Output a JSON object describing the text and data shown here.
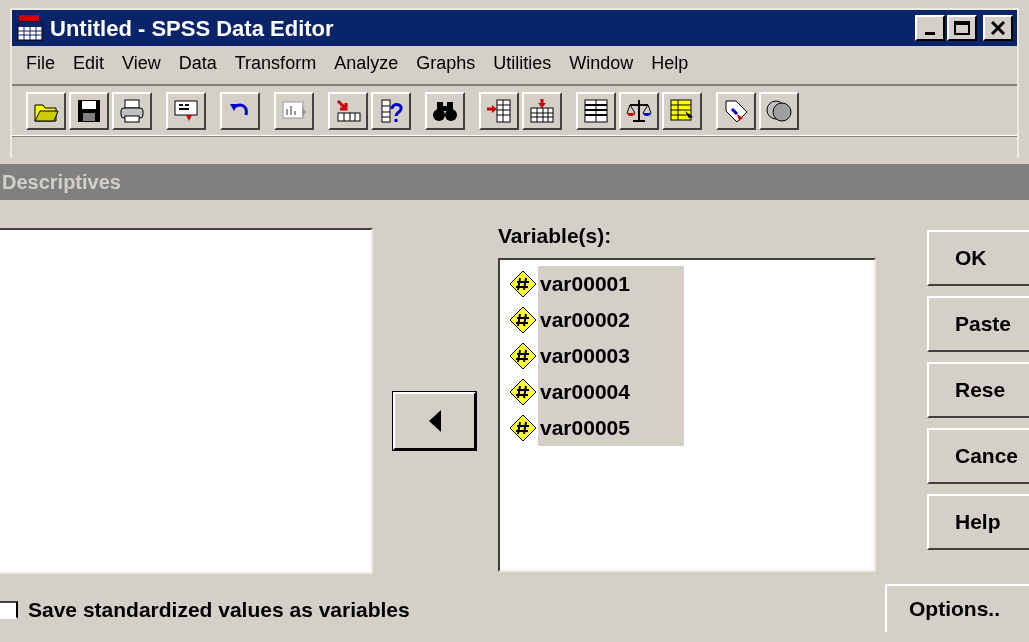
{
  "window": {
    "title": "Untitled - SPSS Data Editor"
  },
  "menu": [
    {
      "label": "File"
    },
    {
      "label": "Edit"
    },
    {
      "label": "View"
    },
    {
      "label": "Data"
    },
    {
      "label": "Transform"
    },
    {
      "label": "Analyze"
    },
    {
      "label": "Graphs"
    },
    {
      "label": "Utilities"
    },
    {
      "label": "Window"
    },
    {
      "label": "Help"
    }
  ],
  "dialog": {
    "title": "Descriptives",
    "variables_label": {
      "label": "Variable(s):"
    },
    "variables": [
      {
        "name": "var00001",
        "selected": true
      },
      {
        "name": "var00002",
        "selected": true
      },
      {
        "name": "var00003",
        "selected": true
      },
      {
        "name": "var00004",
        "selected": true
      },
      {
        "name": "var00005",
        "selected": true
      }
    ],
    "buttons": [
      {
        "label": "OK"
      },
      {
        "label": "Paste"
      },
      {
        "label": "Rese"
      },
      {
        "label": "Cance"
      },
      {
        "label": "Help"
      }
    ],
    "save_standardized": {
      "label": "Save standardized values as variables",
      "checked": false
    },
    "options_button": {
      "label": "Options.."
    }
  }
}
